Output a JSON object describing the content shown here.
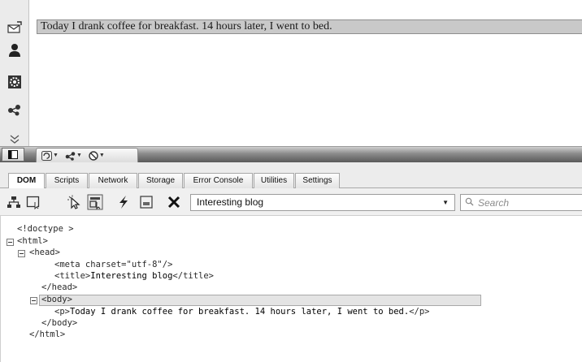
{
  "page": {
    "paragraph_text": "Today I drank coffee for breakfast. 14 hours later, I went to bed."
  },
  "left_panel": {
    "items": [
      {
        "icon": "mail-icon"
      },
      {
        "icon": "person-icon"
      },
      {
        "icon": "gear-icon"
      },
      {
        "icon": "unite-icon"
      },
      {
        "icon": "chevron-double-down-icon"
      }
    ]
  },
  "dragonfly_bar": {
    "icons": [
      "dock-icon",
      "reload-icon",
      "unite-dropdown-icon",
      "debug-dropdown-icon"
    ]
  },
  "tabs": [
    {
      "label": "DOM",
      "active": true
    },
    {
      "label": "Scripts",
      "active": false
    },
    {
      "label": "Network",
      "active": false
    },
    {
      "label": "Storage",
      "active": false
    },
    {
      "label": "Error Console",
      "active": false
    },
    {
      "label": "Utilities",
      "active": false
    },
    {
      "label": "Settings",
      "active": false
    }
  ],
  "toolbar": {
    "document_select_value": "Interesting blog",
    "search_placeholder": "Search",
    "tools": [
      "tree-icon",
      "select-frame-icon",
      "pick-element-icon",
      "highlight-icon",
      "lightning-icon",
      "window-icon",
      "close-x-icon"
    ]
  },
  "dom_tree": {
    "l1": "<!doctype >",
    "l2": "<html>",
    "l3": "<head>",
    "l4_tag": "<meta charset=\"utf-8\"/>",
    "l5_open": "<title>",
    "l5_text": "Interesting blog",
    "l5_close": "</title>",
    "l6": "</head>",
    "l7": "<body>",
    "l8_open": "<p>",
    "l8_text": "Today I drank coffee for breakfast. 14 hours later, I went to bed.",
    "l8_close": "</p>",
    "l9": "</body>",
    "l10": "</html>"
  }
}
